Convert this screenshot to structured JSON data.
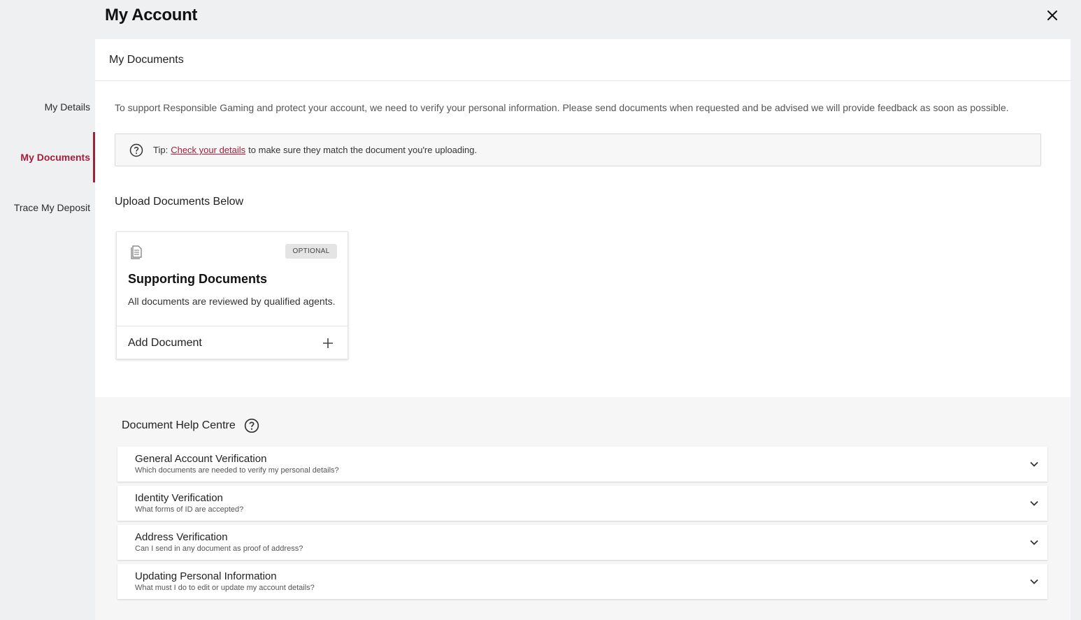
{
  "header": {
    "title": "My Account"
  },
  "sidebar": {
    "items": [
      {
        "label": "My Details"
      },
      {
        "label": "My Documents"
      },
      {
        "label": "Trace My Deposit"
      }
    ]
  },
  "main": {
    "section_title": "My Documents",
    "intro": "To support Responsible Gaming and protect your account, we need to verify your personal information. Please send documents when requested and be advised we will provide feedback as soon as possible.",
    "tip": {
      "prefix": "Tip:",
      "link": "Check your details",
      "suffix": "to make sure they match the document you're uploading."
    },
    "upload_title": "Upload Documents Below",
    "card": {
      "badge": "OPTIONAL",
      "title": "Supporting Documents",
      "description": "All documents are reviewed by qualified agents.",
      "action": "Add Document"
    }
  },
  "help": {
    "title": "Document Help Centre",
    "items": [
      {
        "title": "General Account Verification",
        "subtitle": "Which documents are needed to verify my personal details?"
      },
      {
        "title": "Identity Verification",
        "subtitle": "What forms of ID are accepted?"
      },
      {
        "title": "Address Verification",
        "subtitle": "Can I send in any document as proof of address?"
      },
      {
        "title": "Updating Personal Information",
        "subtitle": "What must I do to edit or update my account details?"
      }
    ]
  },
  "colors": {
    "accent": "#a41f3c",
    "background": "#eff0f1"
  },
  "icons": [
    "close-icon",
    "question-icon",
    "document-icon",
    "plus-icon",
    "chevron-down-icon"
  ]
}
